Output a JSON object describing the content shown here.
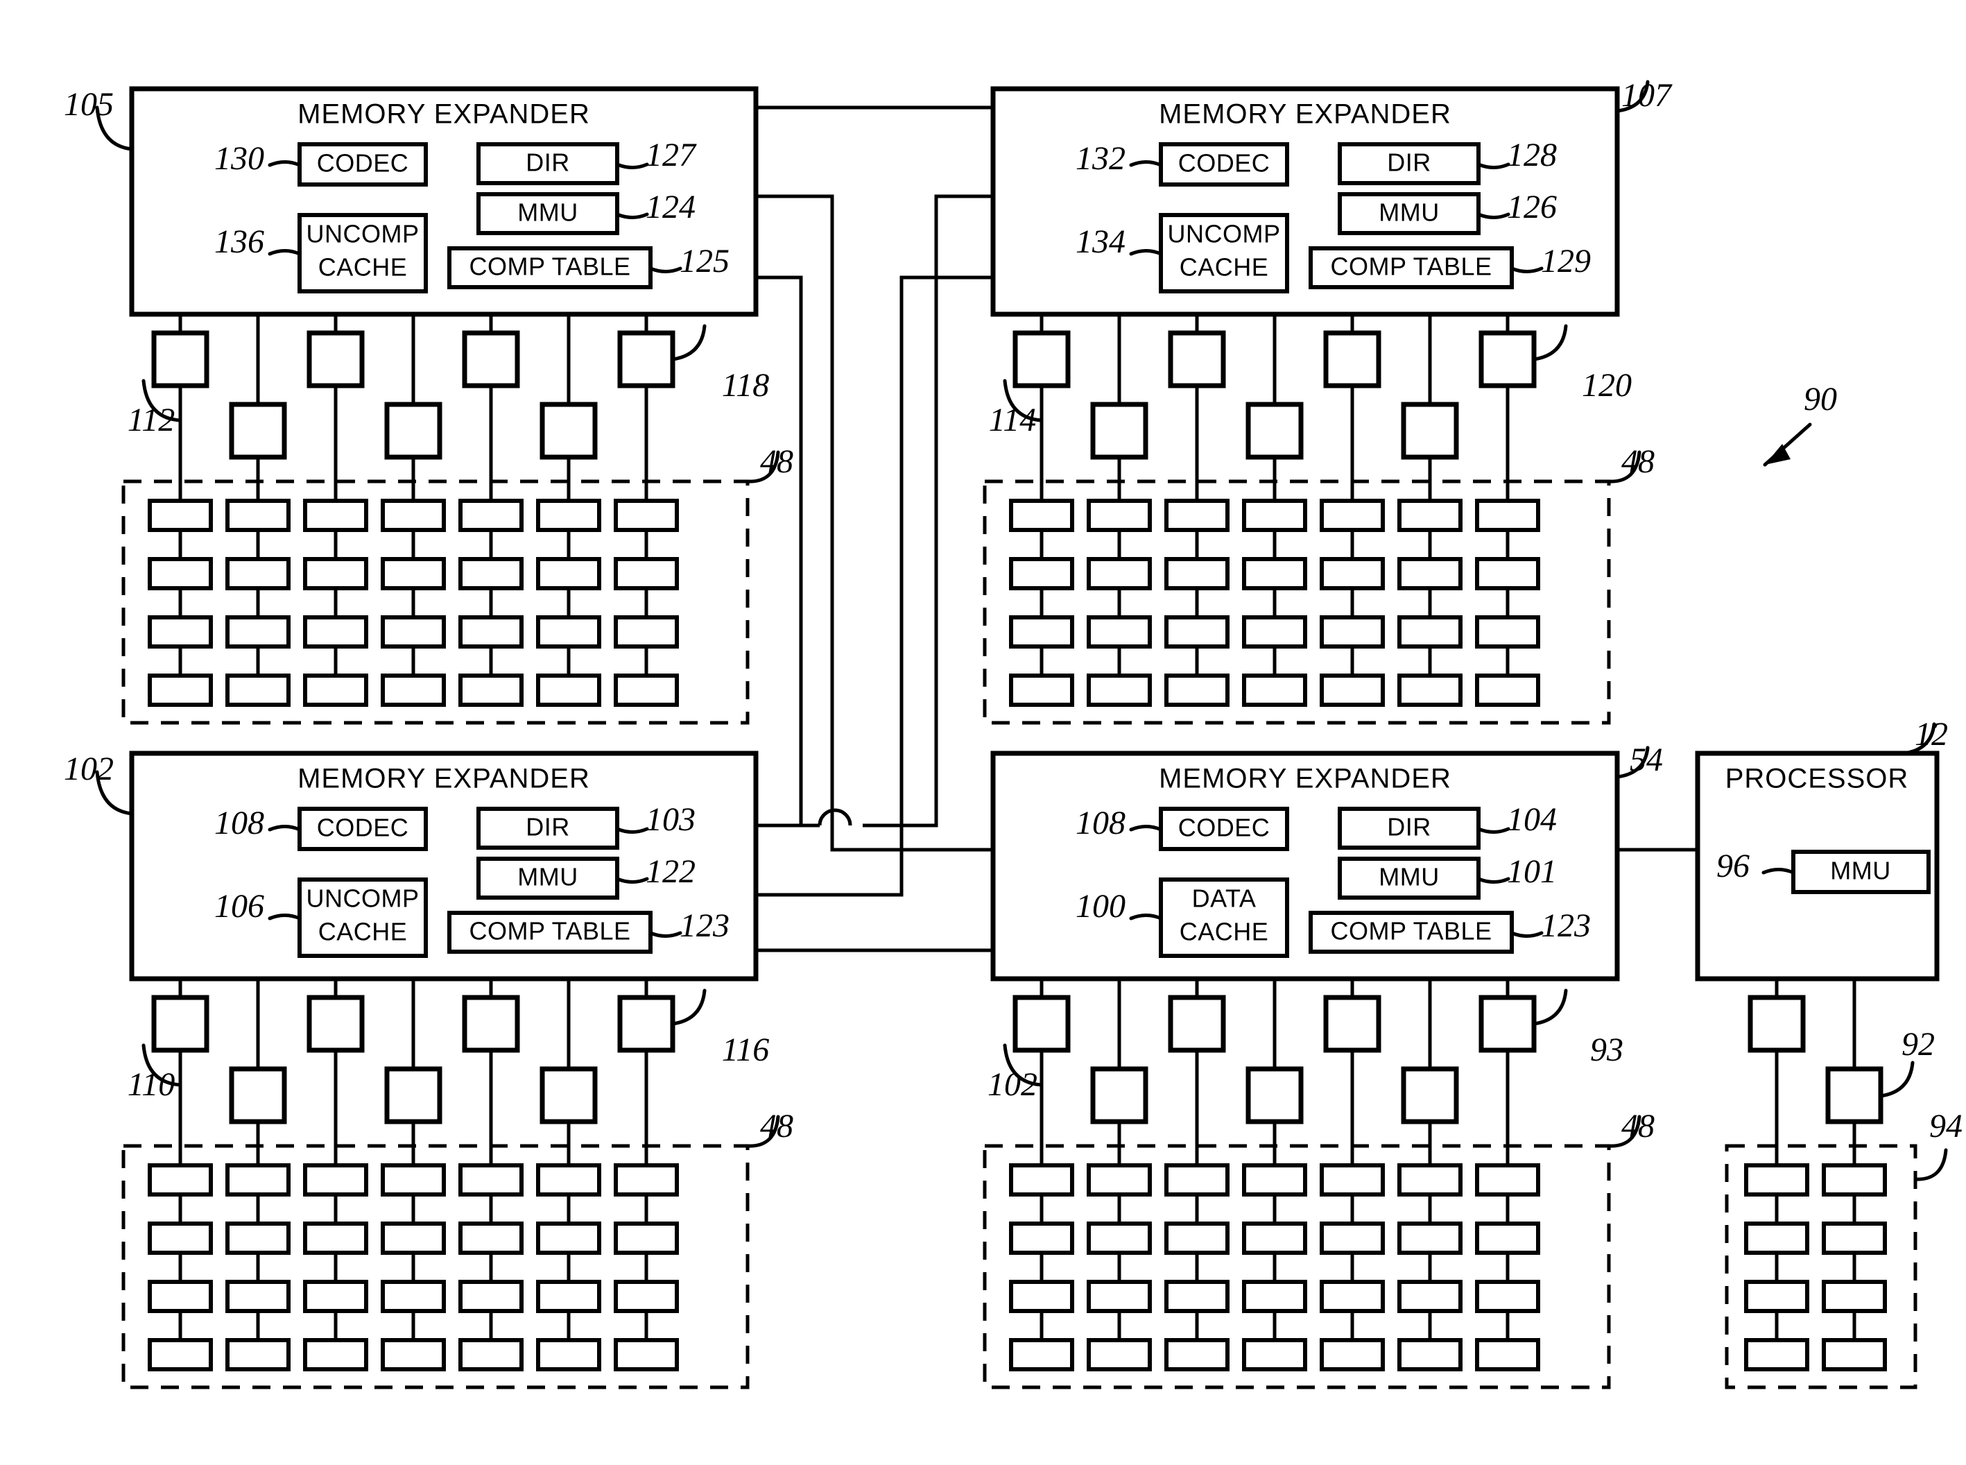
{
  "figure": {
    "system_ref": "90",
    "kind": "patent-block-diagram"
  },
  "expanders": [
    {
      "id": "top-left",
      "title": "MEMORY EXPANDER",
      "ref": "105",
      "left_blocks": [
        {
          "label": "CODEC",
          "ref": "130"
        },
        {
          "label": "UNCOMP\nCACHE",
          "line1": "UNCOMP",
          "line2": "CACHE",
          "ref": "136"
        }
      ],
      "right_blocks": [
        {
          "label": "DIR",
          "ref": "127"
        },
        {
          "label": "MMU",
          "ref": "124"
        },
        {
          "label": "COMP TABLE",
          "ref": "125"
        }
      ],
      "socket_ref_left": "112",
      "socket_ref_right": "118",
      "memory_region_ref": "48"
    },
    {
      "id": "top-right",
      "title": "MEMORY EXPANDER",
      "ref": "107",
      "left_blocks": [
        {
          "label": "CODEC",
          "ref": "132"
        },
        {
          "label": "UNCOMP\nCACHE",
          "line1": "UNCOMP",
          "line2": "CACHE",
          "ref": "134"
        }
      ],
      "right_blocks": [
        {
          "label": "DIR",
          "ref": "128"
        },
        {
          "label": "MMU",
          "ref": "126"
        },
        {
          "label": "COMP TABLE",
          "ref": "129"
        }
      ],
      "socket_ref_left": "114",
      "socket_ref_right": "120",
      "memory_region_ref": "48"
    },
    {
      "id": "bottom-left",
      "title": "MEMORY EXPANDER",
      "ref": "102",
      "left_blocks": [
        {
          "label": "CODEC",
          "ref": "108"
        },
        {
          "label": "UNCOMP\nCACHE",
          "line1": "UNCOMP",
          "line2": "CACHE",
          "ref": "106"
        }
      ],
      "right_blocks": [
        {
          "label": "DIR",
          "ref": "103"
        },
        {
          "label": "MMU",
          "ref": "122"
        },
        {
          "label": "COMP TABLE",
          "ref": "123"
        }
      ],
      "socket_ref_left": "110",
      "socket_ref_right": "116",
      "memory_region_ref": "48"
    },
    {
      "id": "bottom-right",
      "title": "MEMORY EXPANDER",
      "ref": "54",
      "left_blocks": [
        {
          "label": "CODEC",
          "ref": "108"
        },
        {
          "label": "DATA\nCACHE",
          "line1": "DATA",
          "line2": "CACHE",
          "ref": "100"
        }
      ],
      "right_blocks": [
        {
          "label": "DIR",
          "ref": "104"
        },
        {
          "label": "MMU",
          "ref": "101"
        },
        {
          "label": "COMP TABLE",
          "ref": "123"
        }
      ],
      "socket_ref_left": "102",
      "socket_ref_right": "93",
      "memory_region_ref": "48"
    }
  ],
  "processor": {
    "title": "PROCESSOR",
    "ref": "12",
    "blocks": [
      {
        "label": "MMU",
        "ref": "96"
      }
    ],
    "socket_ref": "92",
    "memory_region_ref": "94"
  }
}
